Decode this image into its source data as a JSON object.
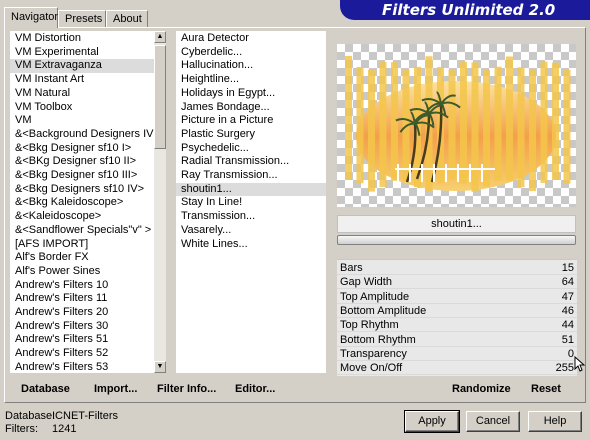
{
  "header": {
    "title": "Filters Unlimited 2.0"
  },
  "tabs": [
    {
      "label": "Navigator",
      "active": true
    },
    {
      "label": "Presets",
      "active": false
    },
    {
      "label": "About",
      "active": false
    }
  ],
  "categories": {
    "items": [
      "VM Distortion",
      "VM Experimental",
      "VM Extravaganza",
      "VM Instant Art",
      "VM Natural",
      "VM Toolbox",
      "VM",
      "&<Background Designers IV>",
      "&<Bkg Designer sf10 I>",
      "&<BKg Designer sf10 II>",
      "&<Bkg Designer sf10 III>",
      "&<Bkg Designers sf10 IV>",
      "&<Bkg Kaleidoscope>",
      "&<Kaleidoscope>",
      "&<Sandflower Specials\"v\" >",
      "[AFS IMPORT]",
      "Alf's Border FX",
      "Alf's Power Sines",
      "Andrew's Filters 10",
      "Andrew's Filters 11",
      "Andrew's Filters 20",
      "Andrew's Filters 30",
      "Andrew's Filters 51",
      "Andrew's Filters 52",
      "Andrew's Filters 53"
    ],
    "selected": "VM Extravaganza"
  },
  "filters": {
    "items": [
      " Aura Detector",
      "Cyberdelic...",
      "Hallucination...",
      "Heightline...",
      "Holidays in Egypt...",
      "James Bondage...",
      "Picture in a Picture",
      "Plastic Surgery",
      "Psychedelic...",
      "Radial Transmission...",
      "Ray Transmission...",
      "shoutin1...",
      "Stay In Line!",
      "Transmission...",
      "Vasarely...",
      "White Lines..."
    ],
    "selected": "shoutin1..."
  },
  "preview": {
    "filter_name": "shoutin1..."
  },
  "params": [
    {
      "label": "Bars",
      "value": "15"
    },
    {
      "label": "Gap Width",
      "value": "64"
    },
    {
      "label": "Top Amplitude",
      "value": "47"
    },
    {
      "label": "Bottom Amplitude",
      "value": "46"
    },
    {
      "label": "Top Rhythm",
      "value": "44"
    },
    {
      "label": "Bottom Rhythm",
      "value": "51"
    },
    {
      "label": "Transparency",
      "value": "0"
    },
    {
      "label": "Move On/Off",
      "value": "255"
    }
  ],
  "toolbar": {
    "database": "Database",
    "import": "Import...",
    "filter_info": "Filter Info...",
    "editor": "Editor...",
    "randomize": "Randomize",
    "reset": "Reset"
  },
  "status": {
    "database_label": "Database:",
    "database_value": "ICNET-Filters",
    "filters_label": "Filters:",
    "filters_value": "1241"
  },
  "buttons": {
    "apply": "Apply",
    "cancel": "Cancel",
    "help": "Help"
  },
  "colors": {
    "banner": "#1a1a9a",
    "bars": "#f3c64a",
    "panel": "#d4d0c8"
  }
}
